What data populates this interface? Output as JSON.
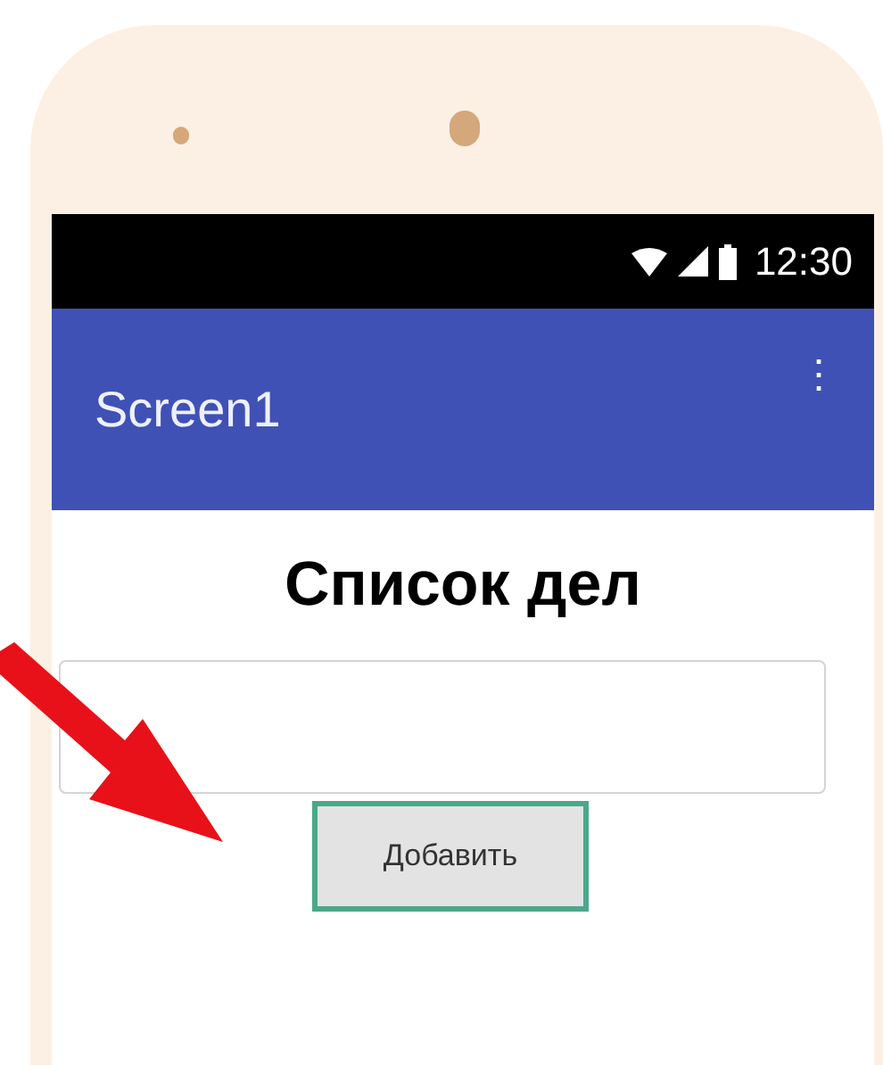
{
  "status_bar": {
    "time": "12:30"
  },
  "app_bar": {
    "title": "Screen1",
    "menu_icon": "⋮"
  },
  "content": {
    "heading": "Список дел",
    "button": {
      "label": "Добавить",
      "selected": true
    }
  },
  "annotation": {
    "kind": "arrow"
  }
}
